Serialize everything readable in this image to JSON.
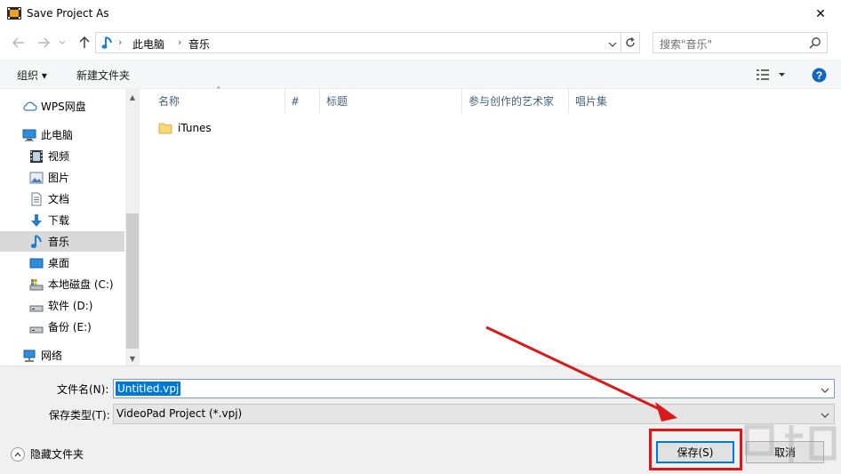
{
  "window": {
    "title": "Save Project As",
    "close_glyph": "✕"
  },
  "address": {
    "crumbs": [
      "此电脑",
      "音乐"
    ],
    "search_placeholder": "搜索\"音乐\""
  },
  "toolbar": {
    "organize": "组织 ▾",
    "new_folder": "新建文件夹"
  },
  "nav": {
    "items": [
      {
        "label": "WPS网盘",
        "icon": "cloud-icon"
      },
      {
        "label": "此电脑",
        "icon": "computer-icon"
      },
      {
        "label": "视频",
        "icon": "video-icon"
      },
      {
        "label": "图片",
        "icon": "pictures-icon"
      },
      {
        "label": "文档",
        "icon": "document-icon"
      },
      {
        "label": "下载",
        "icon": "download-icon"
      },
      {
        "label": "音乐",
        "icon": "music-icon",
        "selected": true
      },
      {
        "label": "桌面",
        "icon": "desktop-icon"
      },
      {
        "label": "本地磁盘 (C:)",
        "icon": "drive-icon"
      },
      {
        "label": "软件 (D:)",
        "icon": "drive-icon"
      },
      {
        "label": "备份 (E:)",
        "icon": "drive-icon"
      },
      {
        "label": "网络",
        "icon": "network-icon"
      }
    ]
  },
  "columns": [
    "名称",
    "#",
    "标题",
    "参与创作的艺术家",
    "唱片集"
  ],
  "files": [
    {
      "name": "iTunes",
      "icon": "folder-icon"
    }
  ],
  "form": {
    "filename_label": "文件名(N):",
    "filename_value": "Untitled.vpj",
    "filetype_label": "保存类型(T):",
    "filetype_value": "VideoPad Project (*.vpj)"
  },
  "footer": {
    "hide_folders": "隐藏文件夹",
    "save": "保存(S)",
    "cancel": "取消"
  },
  "colors": {
    "accent": "#0078d7",
    "highlight": "#e01414",
    "selected_nav": "#d9d9d9"
  }
}
